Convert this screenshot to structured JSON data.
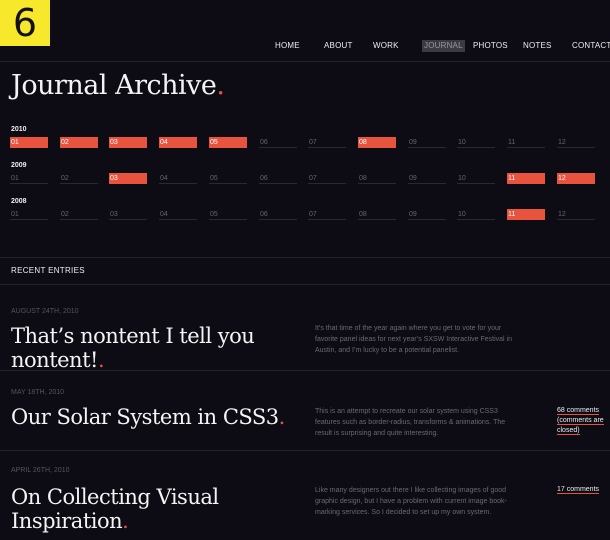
{
  "logo": {
    "text": "6"
  },
  "nav": [
    {
      "label": "HOME"
    },
    {
      "label": "ABOUT"
    },
    {
      "label": "WORK"
    },
    {
      "label": "JOURNAL"
    },
    {
      "label": "PHOTOS"
    },
    {
      "label": "NOTES"
    },
    {
      "label": "CONTACT"
    }
  ],
  "nav_active": "JOURNAL",
  "page_title": "Journal Archive",
  "title_dot": ".",
  "archive": [
    {
      "year": "2010",
      "months": [
        "01",
        "02",
        "03",
        "04",
        "05",
        "06",
        "07",
        "08",
        "09",
        "10",
        "11",
        "12"
      ],
      "active": [
        true,
        true,
        true,
        true,
        true,
        false,
        false,
        true,
        false,
        false,
        false,
        false
      ]
    },
    {
      "year": "2009",
      "months": [
        "01",
        "02",
        "03",
        "04",
        "05",
        "06",
        "07",
        "08",
        "09",
        "10",
        "11",
        "12"
      ],
      "active": [
        false,
        false,
        true,
        false,
        false,
        false,
        false,
        false,
        false,
        false,
        true,
        true
      ]
    },
    {
      "year": "2008",
      "months": [
        "01",
        "02",
        "03",
        "04",
        "05",
        "06",
        "07",
        "08",
        "09",
        "10",
        "11",
        "12"
      ],
      "active": [
        false,
        false,
        false,
        false,
        false,
        false,
        false,
        false,
        false,
        false,
        true,
        false
      ]
    }
  ],
  "recent_heading": "RECENT ENTRIES",
  "entries": [
    {
      "date": "AUGUST 24TH, 2010",
      "title": "That’s nontent I tell you nontent!",
      "excerpt": "It’s that time of the year again where you get to vote for your favorite panel ideas for next year’s SXSW Interactive Festival in Austin, and I’m lucky to be a potential panelist.",
      "comments": ""
    },
    {
      "date": "MAY 18TH, 2010",
      "title": "Our Solar System in CSS3",
      "excerpt": "This is an attempt to recreate our solar system using CSS3 features such as border-radius, transforms & animations. The result is surprising and quite interesting.",
      "comments": "68 comments (comments are closed)"
    },
    {
      "date": "APRIL 26TH, 2010",
      "title": "On Collecting Visual Inspiration",
      "excerpt": "Like many designers out there I like collecting images of good graphic design, but I have a problem with current image book-marking services. So I decided to set up my own system.",
      "comments": "17 comments"
    }
  ],
  "colors": {
    "accent": "#e8533e",
    "logo_bg": "#f7e82c",
    "background": "#0d0b14"
  }
}
